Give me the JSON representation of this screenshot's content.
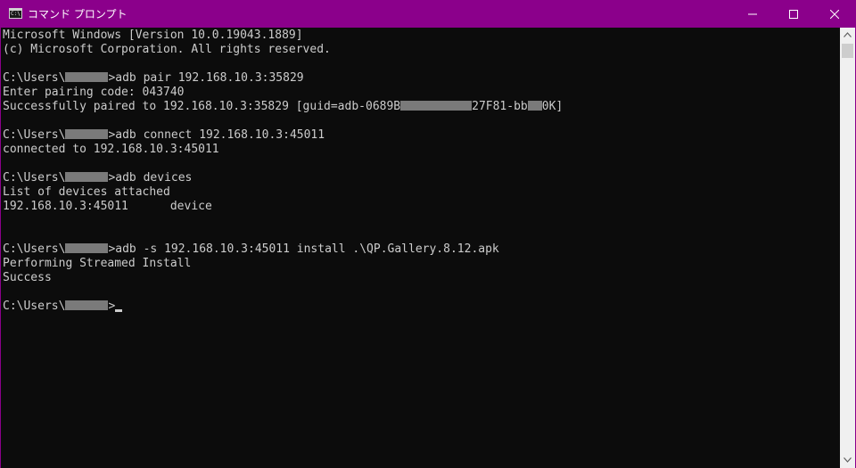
{
  "window": {
    "title": "コマンド プロンプト",
    "app_icon": "console-icon",
    "app_icon_glyph": "C:\\",
    "controls": [
      "minimize-icon",
      "maximize-icon",
      "close-icon"
    ],
    "accent_color": "#8b008b"
  },
  "console": {
    "background": "#0c0c0c",
    "foreground": "#cccccc",
    "lines": [
      [
        "Microsoft Windows [Version 10.0.19043.1889]"
      ],
      [
        "(c) Microsoft Corporation. All rights reserved."
      ],
      [
        ""
      ],
      [
        "C:\\Users\\",
        "",
        ">adb pair 192.168.10.3:35829"
      ],
      [
        "Enter pairing code: 043740"
      ],
      [
        "Successfully paired to 192.168.10.3:35829 [guid=adb-0689B",
        "",
        "27F81-bb",
        "",
        "0K]"
      ],
      [
        ""
      ],
      [
        "C:\\Users\\",
        "",
        ">adb connect 192.168.10.3:45011"
      ],
      [
        "connected to 192.168.10.3:45011"
      ],
      [
        ""
      ],
      [
        "C:\\Users\\",
        "",
        ">adb devices"
      ],
      [
        "List of devices attached"
      ],
      [
        "192.168.10.3:45011      device"
      ],
      [
        ""
      ],
      [
        ""
      ],
      [
        "C:\\Users\\",
        "",
        ">adb -s 192.168.10.3:45011 install .\\QP.Gallery.8.12.apk"
      ],
      [
        "Performing Streamed Install"
      ],
      [
        "Success"
      ],
      [
        ""
      ],
      [
        "C:\\Users\\",
        "",
        ">"
      ]
    ],
    "redactions": {
      "3": [
        1
      ],
      "5": [
        1,
        3
      ],
      "7": [
        1
      ],
      "10": [
        1
      ],
      "15": [
        1
      ],
      "19": [
        1
      ]
    },
    "cursor_line": 19
  },
  "scrollbar": {
    "up_icon": "scroll-up-arrow-icon",
    "down_icon": "scroll-down-arrow-icon"
  }
}
